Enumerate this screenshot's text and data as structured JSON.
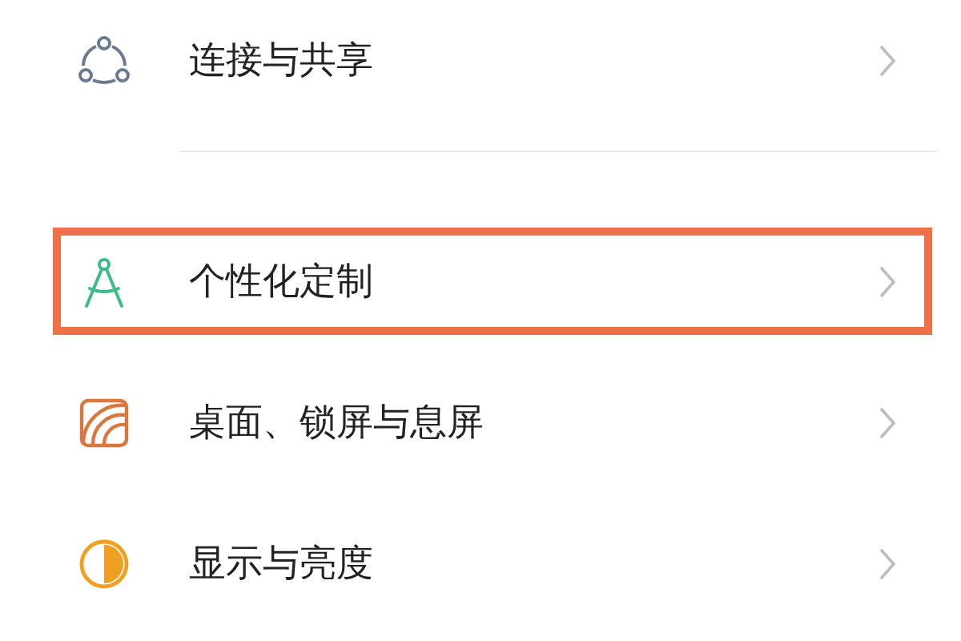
{
  "settings_items": [
    {
      "kind": "share",
      "label": "连接与共享",
      "highlighted": false
    },
    {
      "kind": "compass",
      "label": "个性化定制",
      "highlighted": true
    },
    {
      "kind": "wallpaper",
      "label": "桌面、锁屏与息屏",
      "highlighted": false
    },
    {
      "kind": "display",
      "label": "显示与亮度",
      "highlighted": false
    }
  ]
}
